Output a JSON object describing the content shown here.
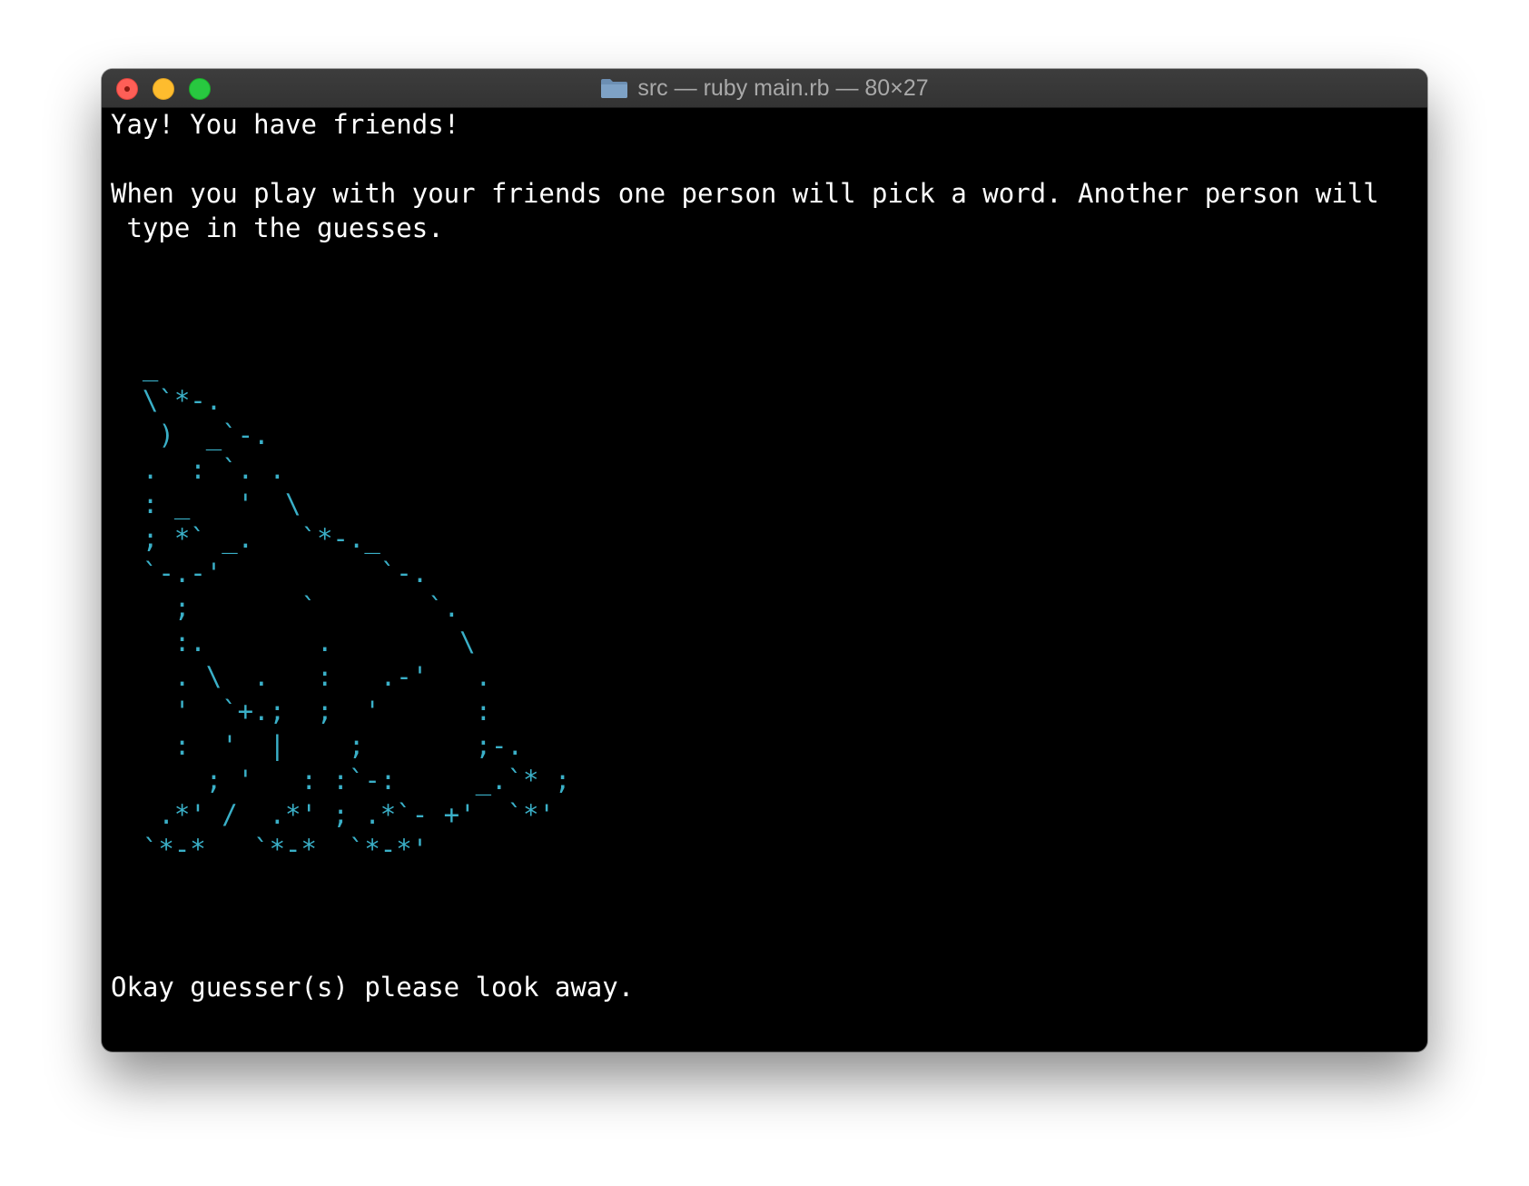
{
  "window": {
    "title": "src — ruby main.rb — 80×27",
    "folder_icon": "folder-icon",
    "buttons": {
      "close": "close-button",
      "minimize": "minimize-button",
      "zoom": "zoom-button"
    }
  },
  "colors": {
    "background": "#000000",
    "text": "#ffffff",
    "art": "#3ab0c8",
    "titlebar": "#383838"
  },
  "terminal": {
    "intro": "Yay! You have friends!",
    "instructions_line1": "When you play with your friends one person will pick a word. Another person will",
    "instructions_line2": " type in the guesses.",
    "art_lines": [
      "  _",
      "  \\`*-.",
      "   )  _`-.",
      "  .  : `. .",
      "  : _   '  \\",
      "  ; *` _.   `*-._",
      "  `-.-'          `-.",
      "    ;       `       `.",
      "    :.       .        \\",
      "    . \\  .   :   .-'   .",
      "    '  `+.;  ;  '      :",
      "    :  '  |    ;       ;-.",
      "      ; '   : :`-:     _.`* ;",
      "   .*' /  .*' ; .*`- +'  `*'",
      "  `*-*   `*-*  `*-*'"
    ],
    "prompt": "Okay guesser(s) please look away."
  }
}
